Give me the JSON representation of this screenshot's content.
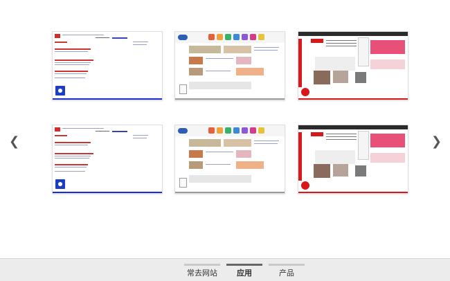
{
  "navigation": {
    "prev_icon": "chevron-left-icon",
    "prev_symbol": "❮",
    "next_icon": "chevron-right-icon",
    "next_symbol": "❯"
  },
  "thumbnails": [
    {
      "site": "baidu",
      "bar_color": "#1a2ed1"
    },
    {
      "site": "hao",
      "bar_color": "#9a9a9a"
    },
    {
      "site": "163",
      "bar_color": "#d8191b"
    },
    {
      "site": "baidu",
      "bar_color": "#1a2ed1"
    },
    {
      "site": "hao",
      "bar_color": "#9a9a9a"
    },
    {
      "site": "163",
      "bar_color": "#d8191b"
    }
  ],
  "footer": {
    "tabs": [
      {
        "label": "常去网站",
        "active": false
      },
      {
        "label": "应用",
        "active": true
      },
      {
        "label": "产品",
        "active": false
      }
    ]
  }
}
